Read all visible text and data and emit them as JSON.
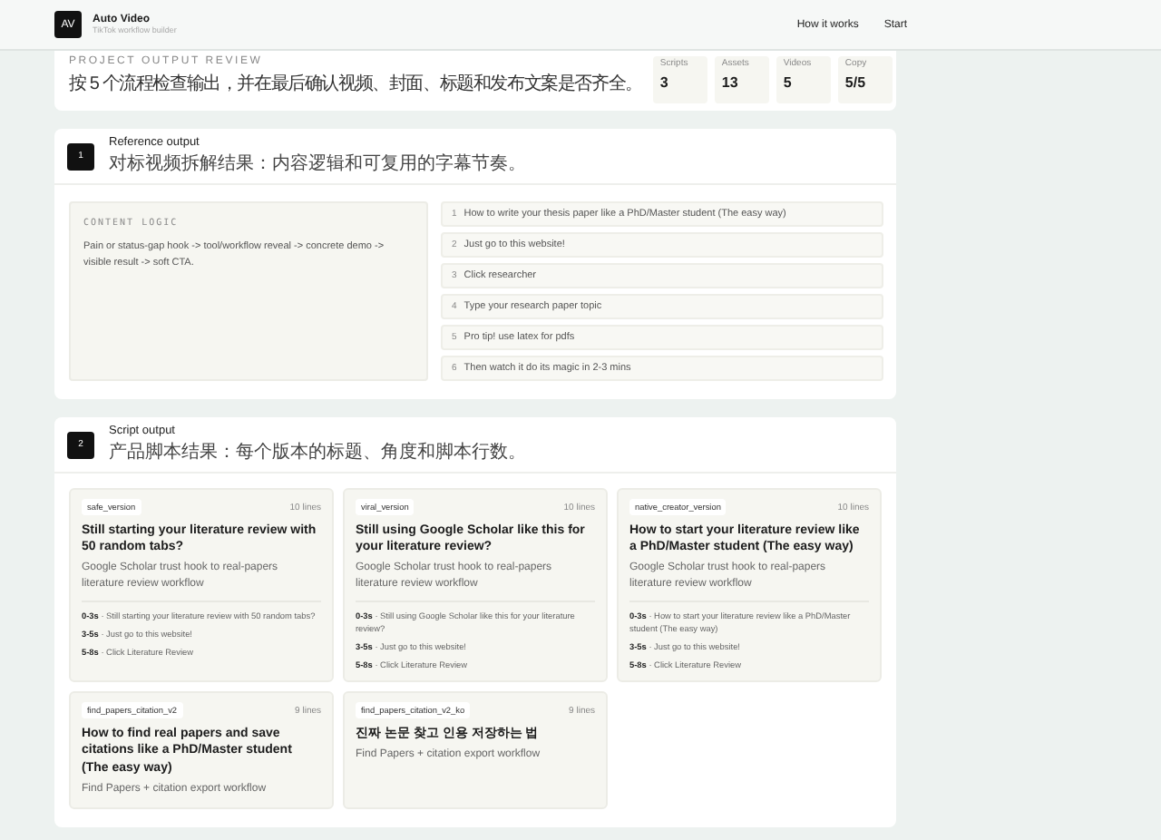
{
  "header": {
    "logo": "AV",
    "title": "Auto Video",
    "subtitle": "TikTok workflow builder",
    "nav": [
      "How it works",
      "Start"
    ]
  },
  "overview": {
    "eyebrow": "PROJECT OUTPUT REVIEW",
    "description": "按 5 个流程检查输出，并在最后确认视频、封面、标题和发布文案是否齐全。",
    "stats": [
      {
        "label": "Scripts",
        "value": "3"
      },
      {
        "label": "Assets",
        "value": "13"
      },
      {
        "label": "Videos",
        "value": "5"
      },
      {
        "label": "Copy",
        "value": "5/5"
      }
    ]
  },
  "sections": [
    {
      "kind": "reference",
      "number": "1",
      "title": "Reference output",
      "subtitle": "对标视频拆解结果：内容逻辑和可复用的字幕节奏。",
      "content_logic": {
        "label": "CONTENT LOGIC",
        "text": "Pain or status-gap hook -> tool/workflow reveal -> concrete demo -> visible result -> soft CTA."
      },
      "captions": [
        {
          "index": "1",
          "text": "How to write your thesis paper like a PhD/Master student (The easy way)"
        },
        {
          "index": "2",
          "text": "Just go to this website!"
        },
        {
          "index": "3",
          "text": "Click researcher"
        },
        {
          "index": "4",
          "text": "Type your research paper topic"
        },
        {
          "index": "5",
          "text": "Pro tip! use latex for pdfs"
        },
        {
          "index": "6",
          "text": "Then watch it do its magic in 2-3 mins"
        }
      ]
    },
    {
      "kind": "scripts",
      "number": "2",
      "title": "Script output",
      "subtitle": "产品脚本结果：每个版本的标题、角度和脚本行数。",
      "scripts": [
        {
          "tag": "safe_version",
          "lines": "10 lines",
          "title": "Still starting your literature review with 50 random tabs?",
          "description": "Google Scholar trust hook to real-papers literature review workflow",
          "beats": [
            "**0-3s** · Still starting your literature review with 50 random tabs?",
            "**3-5s** · Just go to this website!",
            "**5-8s** · Click Literature Review"
          ]
        },
        {
          "tag": "viral_version",
          "lines": "10 lines",
          "title": "Still using Google Scholar like this for your literature review?",
          "description": "Google Scholar trust hook to real-papers literature review workflow",
          "beats": [
            "**0-3s** · Still using Google Scholar like this for your literature review?",
            "**3-5s** · Just go to this website!",
            "**5-8s** · Click Literature Review"
          ]
        },
        {
          "tag": "native_creator_version",
          "lines": "10 lines",
          "title": "How to start your literature review like a PhD/Master student (The easy way)",
          "description": "Google Scholar trust hook to real-papers literature review workflow",
          "beats": [
            "**0-3s** · How to start your literature review like a PhD/Master student (The easy way)",
            "**3-5s** · Just go to this website!",
            "**5-8s** · Click Literature Review"
          ]
        },
        {
          "tag": "find_papers_citation_v2",
          "lines": "9 lines",
          "title": "How to find real papers and save citations like a PhD/Master student (The easy way)",
          "description": "Find Papers + citation export workflow"
        },
        {
          "tag": "find_papers_citation_v2_ko",
          "lines": "9 lines",
          "title": "진짜 논문 찾고 인용 저장하는 법",
          "description": "Find Papers + citation export workflow"
        }
      ]
    }
  ]
}
